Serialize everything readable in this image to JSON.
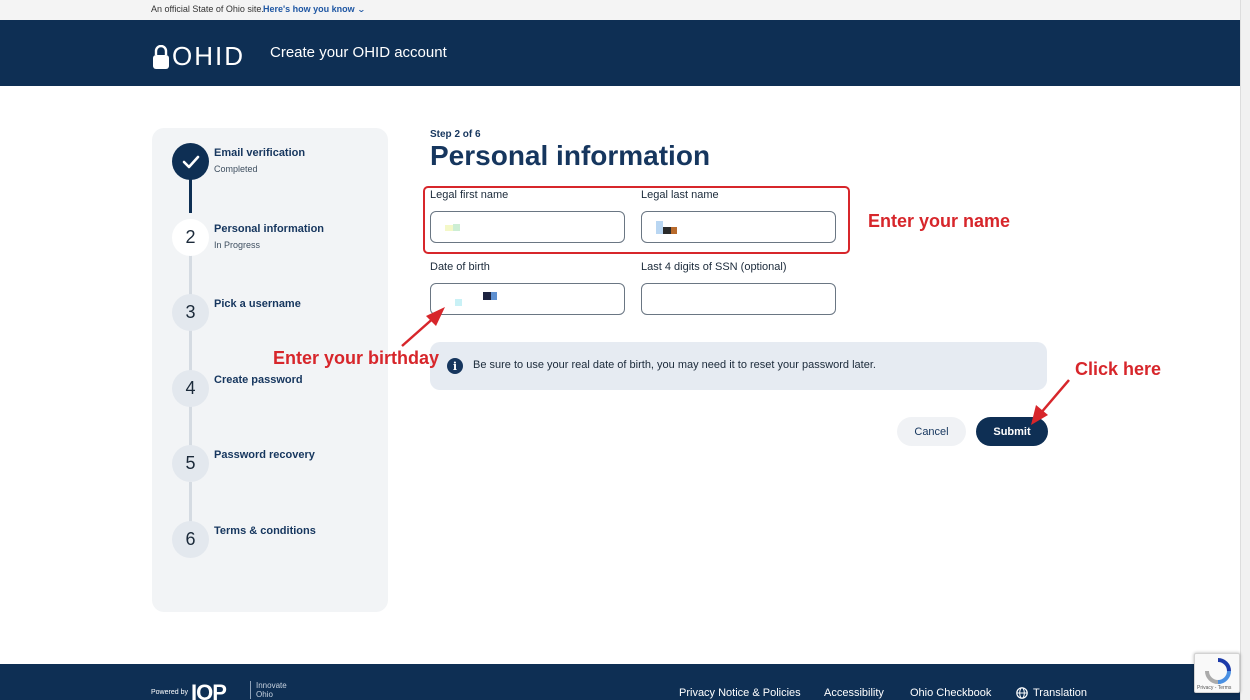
{
  "gov_banner": {
    "text": "An official State of Ohio site.",
    "link": "Here's how you know"
  },
  "header": {
    "logo": "OHID",
    "title": "Create your OHID account"
  },
  "stepper": {
    "steps": [
      {
        "number": "1",
        "title": "Email verification",
        "status": "Completed",
        "state": "done"
      },
      {
        "number": "2",
        "title": "Personal information",
        "status": "In Progress",
        "state": "current"
      },
      {
        "number": "3",
        "title": "Pick a username",
        "status": "",
        "state": "todo"
      },
      {
        "number": "4",
        "title": "Create password",
        "status": "",
        "state": "todo"
      },
      {
        "number": "5",
        "title": "Password recovery",
        "status": "",
        "state": "todo"
      },
      {
        "number": "6",
        "title": "Terms & conditions",
        "status": "",
        "state": "todo"
      }
    ]
  },
  "form": {
    "step_count": "Step 2 of 6",
    "title": "Personal information",
    "first_name_label": "Legal first name",
    "last_name_label": "Legal last name",
    "dob_label": "Date of birth",
    "ssn_label": "Last 4 digits of SSN (optional)",
    "info_text": "Be sure to use your real date of birth, you may need it to reset your password later.",
    "cancel_label": "Cancel",
    "submit_label": "Submit"
  },
  "annotations": {
    "name": "Enter your name",
    "birthday": "Enter your birthday",
    "click": "Click here",
    "color": "#d7262b"
  },
  "footer": {
    "powered_by": "Powered by",
    "iop": "IOP",
    "innovate": [
      "Innovate",
      "Ohio"
    ],
    "links": [
      "Privacy Notice & Policies",
      "Accessibility",
      "Ohio Checkbook",
      "Translation"
    ]
  },
  "recaptcha": {
    "text": "Privacy - Terms"
  },
  "colors": {
    "brand": "#0e2f54",
    "accent": "#16365e"
  }
}
